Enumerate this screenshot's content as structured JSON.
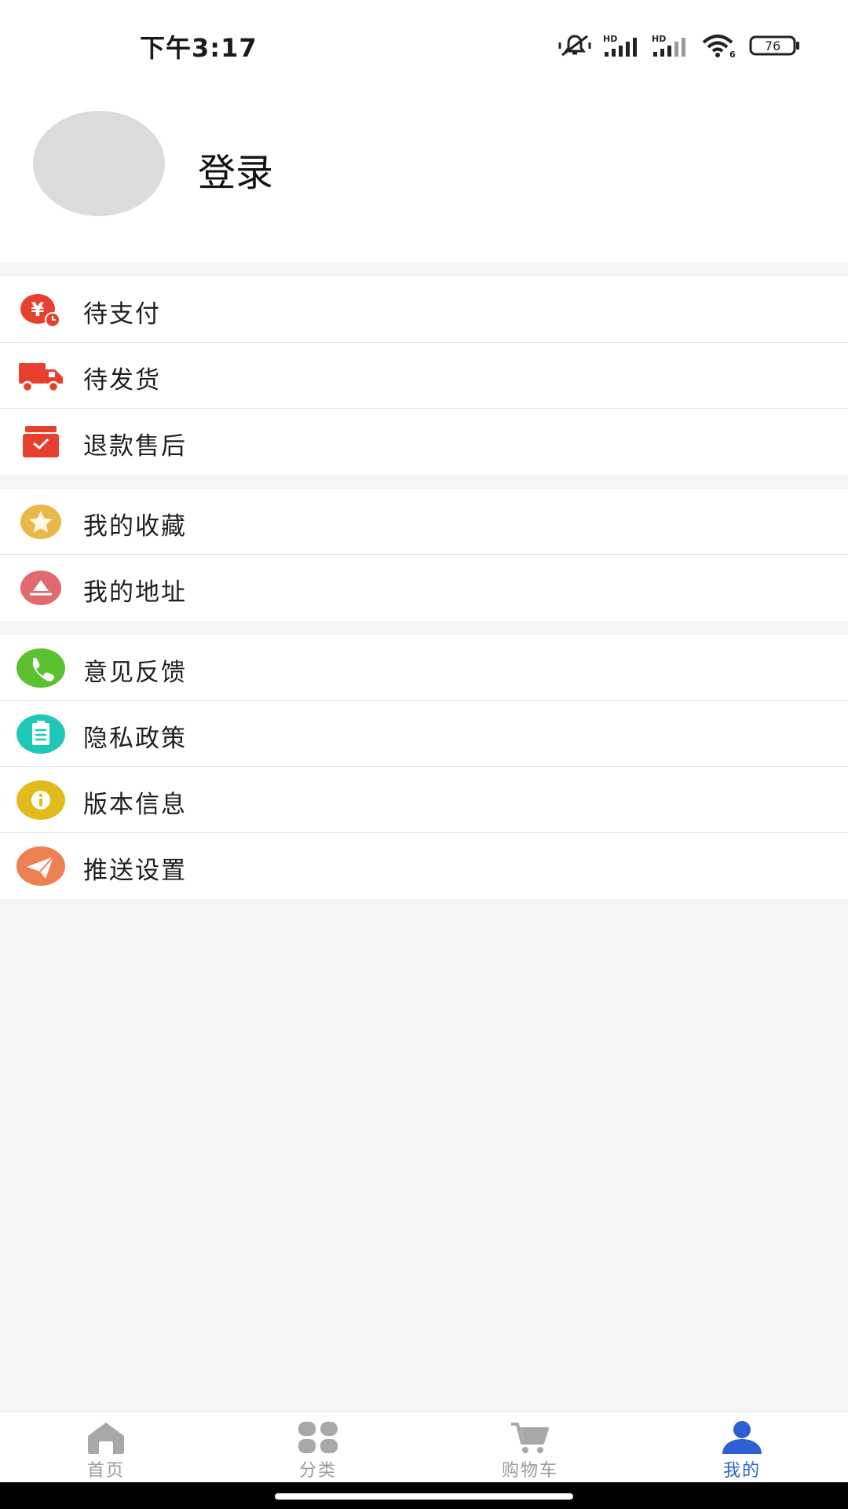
{
  "status_bar": {
    "time": "下午3:17",
    "battery": "76",
    "network_1": "HD",
    "network_2": "HD",
    "wifi_badge": "6"
  },
  "profile": {
    "login_label": "登录"
  },
  "orders": [
    {
      "label": "待支付",
      "icon": "pending-payment-icon",
      "color": "#e8402f"
    },
    {
      "label": "待发货",
      "icon": "delivery-truck-icon",
      "color": "#e8402f"
    },
    {
      "label": "退款售后",
      "icon": "refund-box-icon",
      "color": "#e8402f"
    }
  ],
  "personal": [
    {
      "label": "我的收藏",
      "icon": "star-icon",
      "color": "#e8b84a"
    },
    {
      "label": "我的地址",
      "icon": "address-icon",
      "color": "#e06a6e"
    }
  ],
  "settings": [
    {
      "label": "意见反馈",
      "icon": "phone-icon",
      "color": "#5cc12e"
    },
    {
      "label": "隐私政策",
      "icon": "clipboard-icon",
      "color": "#1fc7b8"
    },
    {
      "label": "版本信息",
      "icon": "info-icon",
      "color": "#e1bb1c"
    },
    {
      "label": "推送设置",
      "icon": "paper-plane-icon",
      "color": "#ee7f50"
    }
  ],
  "tabbar": {
    "home": "首页",
    "category": "分类",
    "cart": "购物车",
    "mine": "我的",
    "active_color": "#2f5fd0",
    "inactive_color": "#9a9a9a"
  }
}
